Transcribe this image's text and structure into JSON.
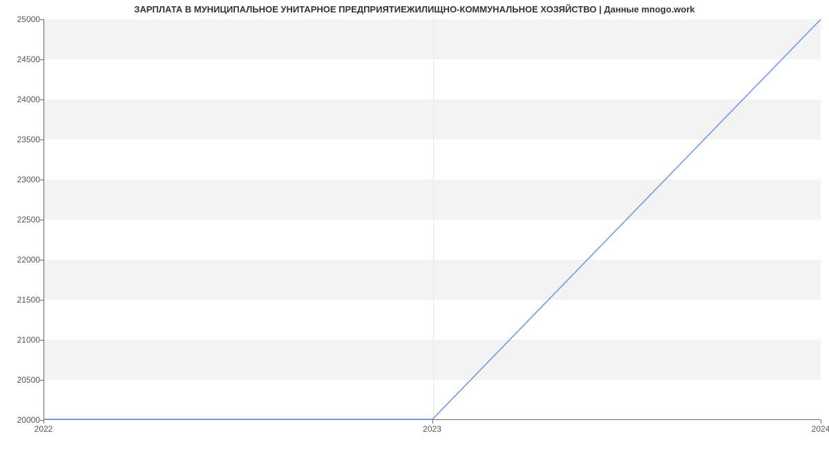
{
  "chart_data": {
    "type": "line",
    "title": "ЗАРПЛАТА В МУНИЦИПАЛЬНОЕ УНИТАРНОЕ ПРЕДПРИЯТИЕЖИЛИЩНО-КОММУНАЛЬНОЕ ХОЗЯЙСТВО | Данные mnogo.work",
    "x": [
      2022,
      2023,
      2024
    ],
    "values": [
      20000,
      20000,
      25000
    ],
    "x_ticks": [
      2022,
      2023,
      2024
    ],
    "y_ticks": [
      20000,
      20500,
      21000,
      21500,
      22000,
      22500,
      23000,
      23500,
      24000,
      24500,
      25000
    ],
    "xlabel": "",
    "ylabel": "",
    "xlim": [
      2022,
      2024
    ],
    "ylim": [
      20000,
      25000
    ],
    "line_color": "#6495ed",
    "band_color": "#f3f3f3",
    "grid": true
  }
}
